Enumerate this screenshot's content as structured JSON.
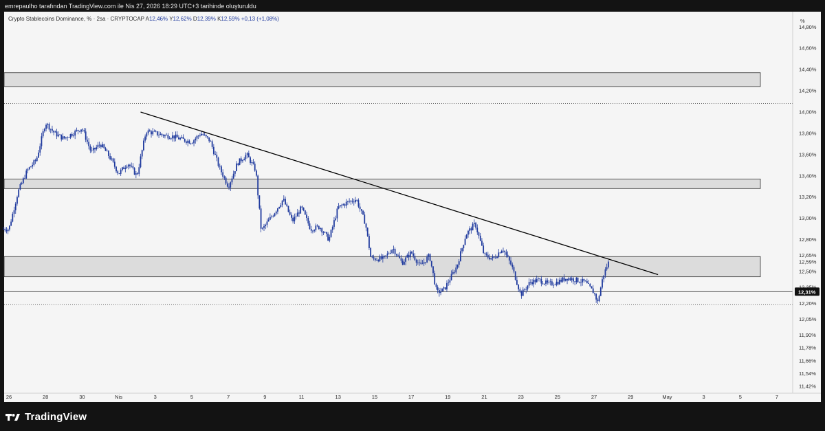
{
  "header": {
    "credit": "emrepaulho tarafından TradingView.com ile Nis 27, 2026 18:29 UTC+3 tarihinde oluşturuldu"
  },
  "legend": {
    "symbol": "Crypto Stablecoins Dominance, % · 2sa · CRYPTOCAP",
    "open_key": "A",
    "open_val": "12,46%",
    "high_key": "Y",
    "high_val": "12,62%",
    "low_key": "D",
    "low_val": "12,39%",
    "close_key": "K",
    "close_val": "12,59%",
    "change": "+0,13 (+1,08%)"
  },
  "footer": {
    "brand": "TradingView"
  },
  "colors": {
    "candle": "#1f3a9e",
    "zone_fill": "#dcdcdc",
    "zone_stroke": "#333333",
    "trendline": "#000000",
    "page_bg": "#131313",
    "chart_bg": "#f5f5f5"
  },
  "chart_data": {
    "type": "candlestick",
    "unit_label": "%",
    "y_range": [
      11.4,
      14.86
    ],
    "y_ticks": [
      "14,80%",
      "14,60%",
      "14,40%",
      "14,20%",
      "14,00%",
      "13,80%",
      "13,60%",
      "13,40%",
      "13,20%",
      "13,00%",
      "12,80%",
      "12,65%",
      "12,59%",
      "12,50%",
      "12,35%",
      "12,20%",
      "12,05%",
      "11,90%",
      "11,78%",
      "11,66%",
      "11,54%",
      "11,42%"
    ],
    "price_tag": "12,31%",
    "x_ticks": [
      "26",
      "28",
      "30",
      "Nis",
      "3",
      "5",
      "7",
      "9",
      "11",
      "13",
      "15",
      "17",
      "19",
      "21",
      "23",
      "25",
      "27",
      "29",
      "May",
      "3",
      "5",
      "7"
    ],
    "x_days": [
      0,
      2,
      4,
      6,
      8,
      10,
      12,
      14,
      16,
      18,
      20,
      22,
      24,
      26,
      28,
      30,
      32,
      34,
      36,
      38,
      40,
      42
    ],
    "series": [
      {
        "day": 0.0,
        "value": 12.9
      },
      {
        "day": 0.5,
        "value": 13.25
      },
      {
        "day": 1.0,
        "value": 13.45
      },
      {
        "day": 1.5,
        "value": 13.55
      },
      {
        "day": 2.0,
        "value": 13.9
      },
      {
        "day": 2.5,
        "value": 13.8
      },
      {
        "day": 3.0,
        "value": 13.75
      },
      {
        "day": 3.5,
        "value": 13.8
      },
      {
        "day": 4.0,
        "value": 13.85
      },
      {
        "day": 4.5,
        "value": 13.62
      },
      {
        "day": 5.0,
        "value": 13.7
      },
      {
        "day": 5.5,
        "value": 13.58
      },
      {
        "day": 6.0,
        "value": 13.42
      },
      {
        "day": 6.5,
        "value": 13.52
      },
      {
        "day": 7.0,
        "value": 13.4
      },
      {
        "day": 7.5,
        "value": 13.82
      },
      {
        "day": 8.0,
        "value": 13.8
      },
      {
        "day": 8.5,
        "value": 13.78
      },
      {
        "day": 9.0,
        "value": 13.77
      },
      {
        "day": 9.5,
        "value": 13.74
      },
      {
        "day": 10.0,
        "value": 13.72
      },
      {
        "day": 10.5,
        "value": 13.8
      },
      {
        "day": 11.0,
        "value": 13.73
      },
      {
        "day": 11.5,
        "value": 13.48
      },
      {
        "day": 12.0,
        "value": 13.3
      },
      {
        "day": 12.5,
        "value": 13.52
      },
      {
        "day": 13.0,
        "value": 13.6
      },
      {
        "day": 13.5,
        "value": 13.45
      },
      {
        "day": 13.8,
        "value": 12.88
      },
      {
        "day": 14.5,
        "value": 13.05
      },
      {
        "day": 15.0,
        "value": 13.18
      },
      {
        "day": 15.5,
        "value": 12.97
      },
      {
        "day": 16.0,
        "value": 13.1
      },
      {
        "day": 16.5,
        "value": 12.9
      },
      {
        "day": 17.0,
        "value": 12.92
      },
      {
        "day": 17.5,
        "value": 12.8
      },
      {
        "day": 18.0,
        "value": 13.1
      },
      {
        "day": 18.5,
        "value": 13.15
      },
      {
        "day": 19.0,
        "value": 13.18
      },
      {
        "day": 19.5,
        "value": 12.95
      },
      {
        "day": 19.8,
        "value": 12.62
      },
      {
        "day": 20.5,
        "value": 12.62
      },
      {
        "day": 21.0,
        "value": 12.72
      },
      {
        "day": 21.5,
        "value": 12.58
      },
      {
        "day": 22.0,
        "value": 12.68
      },
      {
        "day": 22.5,
        "value": 12.55
      },
      {
        "day": 23.0,
        "value": 12.65
      },
      {
        "day": 23.4,
        "value": 12.3
      },
      {
        "day": 23.8,
        "value": 12.33
      },
      {
        "day": 24.5,
        "value": 12.55
      },
      {
        "day": 25.0,
        "value": 12.85
      },
      {
        "day": 25.5,
        "value": 12.95
      },
      {
        "day": 26.0,
        "value": 12.65
      },
      {
        "day": 26.5,
        "value": 12.62
      },
      {
        "day": 27.0,
        "value": 12.72
      },
      {
        "day": 27.5,
        "value": 12.55
      },
      {
        "day": 28.0,
        "value": 12.28
      },
      {
        "day": 28.5,
        "value": 12.4
      },
      {
        "day": 29.0,
        "value": 12.42
      },
      {
        "day": 29.5,
        "value": 12.38
      },
      {
        "day": 30.0,
        "value": 12.4
      },
      {
        "day": 30.5,
        "value": 12.44
      },
      {
        "day": 31.0,
        "value": 12.42
      },
      {
        "day": 31.5,
        "value": 12.4
      },
      {
        "day": 32.0,
        "value": 12.3
      },
      {
        "day": 32.2,
        "value": 12.21
      },
      {
        "day": 32.5,
        "value": 12.46
      },
      {
        "day": 32.8,
        "value": 12.59
      }
    ],
    "zones": [
      {
        "low": 14.24,
        "high": 14.37
      },
      {
        "low": 13.28,
        "high": 13.37
      },
      {
        "low": 12.45,
        "high": 12.64
      }
    ],
    "horizontal_lines": [
      {
        "value": 14.08,
        "style": "dotted"
      },
      {
        "value": 12.31,
        "style": "solid"
      },
      {
        "value": 12.19,
        "style": "dotted"
      }
    ],
    "trendline": {
      "from": {
        "day": 7.2,
        "value": 14.0
      },
      "to": {
        "day": 35.5,
        "value": 12.47
      }
    }
  }
}
